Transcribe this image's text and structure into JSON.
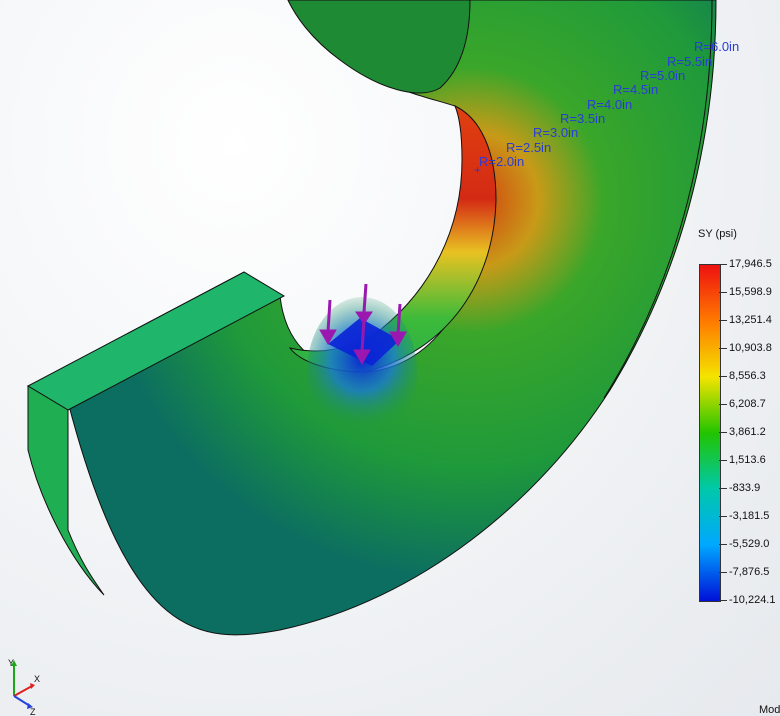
{
  "viewport": {
    "radius_labels": [
      "R=6.0in",
      "R=5.5in",
      "R=5.0in",
      "R=4.5in",
      "R=4.0in",
      "R=3.5in",
      "R=3.0in",
      "R=2.5in",
      "R=2.0in"
    ]
  },
  "legend": {
    "title": "SY (psi)",
    "ticks": [
      "17,946.5",
      "15,598.9",
      "13,251.4",
      "10,903.8",
      "8,556.3",
      "6,208.7",
      "3,861.2",
      "1,513.6",
      "-833.9",
      "-3,181.5",
      "-5,529.0",
      "-7,876.5",
      "-10,224.1"
    ],
    "colors": [
      "#ee1111",
      "#ff7a00",
      "#f4e400",
      "#22c400",
      "#00c8aa",
      "#00a8ff",
      "#0010d8"
    ]
  },
  "triad": {
    "axes": [
      "Y",
      "X",
      "Z"
    ]
  },
  "status": {
    "mode_text": "Mod"
  }
}
